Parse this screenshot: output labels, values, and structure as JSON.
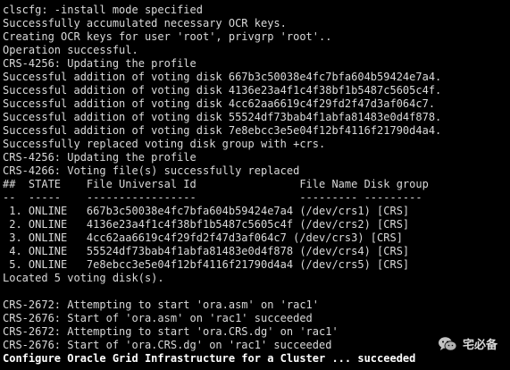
{
  "terminal": {
    "lines": [
      "clscfg: -install mode specified",
      "Successfully accumulated necessary OCR keys.",
      "Creating OCR keys for user 'root', privgrp 'root'..",
      "Operation successful.",
      "CRS-4256: Updating the profile",
      "Successful addition of voting disk 667b3c50038e4fc7bfa604b59424e7a4.",
      "Successful addition of voting disk 4136e23a4f1c4f38bf1b5487c5605c4f.",
      "Successful addition of voting disk 4cc62aa6619c4f29fd2f47d3af064c7.",
      "Successful addition of voting disk 55524df73bab4f1abfa81483e0d4f878.",
      "Successful addition of voting disk 7e8ebcc3e5e04f12bf4116f21790d4a4.",
      "Successfully replaced voting disk group with +crs.",
      "CRS-4256: Updating the profile",
      "CRS-4266: Voting file(s) successfully replaced",
      "##  STATE    File Universal Id                File Name Disk group",
      "--  -----    -----------------                --------- ---------",
      " 1. ONLINE   667b3c50038e4fc7bfa604b59424e7a4 (/dev/crs1) [CRS]",
      " 2. ONLINE   4136e23a4f1c4f38bf1b5487c5605c4f (/dev/crs2) [CRS]",
      " 3. ONLINE   4cc62aa6619c4f29fd2f47d3af064c7 (/dev/crs3) [CRS]",
      " 4. ONLINE   55524df73bab4f1abfa81483e0d4f878 (/dev/crs4) [CRS]",
      " 5. ONLINE   7e8ebcc3e5e04f12bf4116f21790d4a4 (/dev/crs5) [CRS]",
      "Located 5 voting disk(s).",
      "",
      "CRS-2672: Attempting to start 'ora.asm' on 'rac1'",
      "CRS-2676: Start of 'ora.asm' on 'rac1' succeeded",
      "CRS-2672: Attempting to start 'ora.CRS.dg' on 'rac1'",
      "CRS-2676: Start of 'ora.CRS.dg' on 'rac1' succeeded",
      "Configure Oracle Grid Infrastructure for a Cluster ... succeeded"
    ],
    "colors": {
      "background": "#000000",
      "text": "#d9d9d9",
      "bold_text": "#ffffff"
    }
  },
  "watermark": {
    "icon": "wechat-icon",
    "text": "宅必备"
  }
}
